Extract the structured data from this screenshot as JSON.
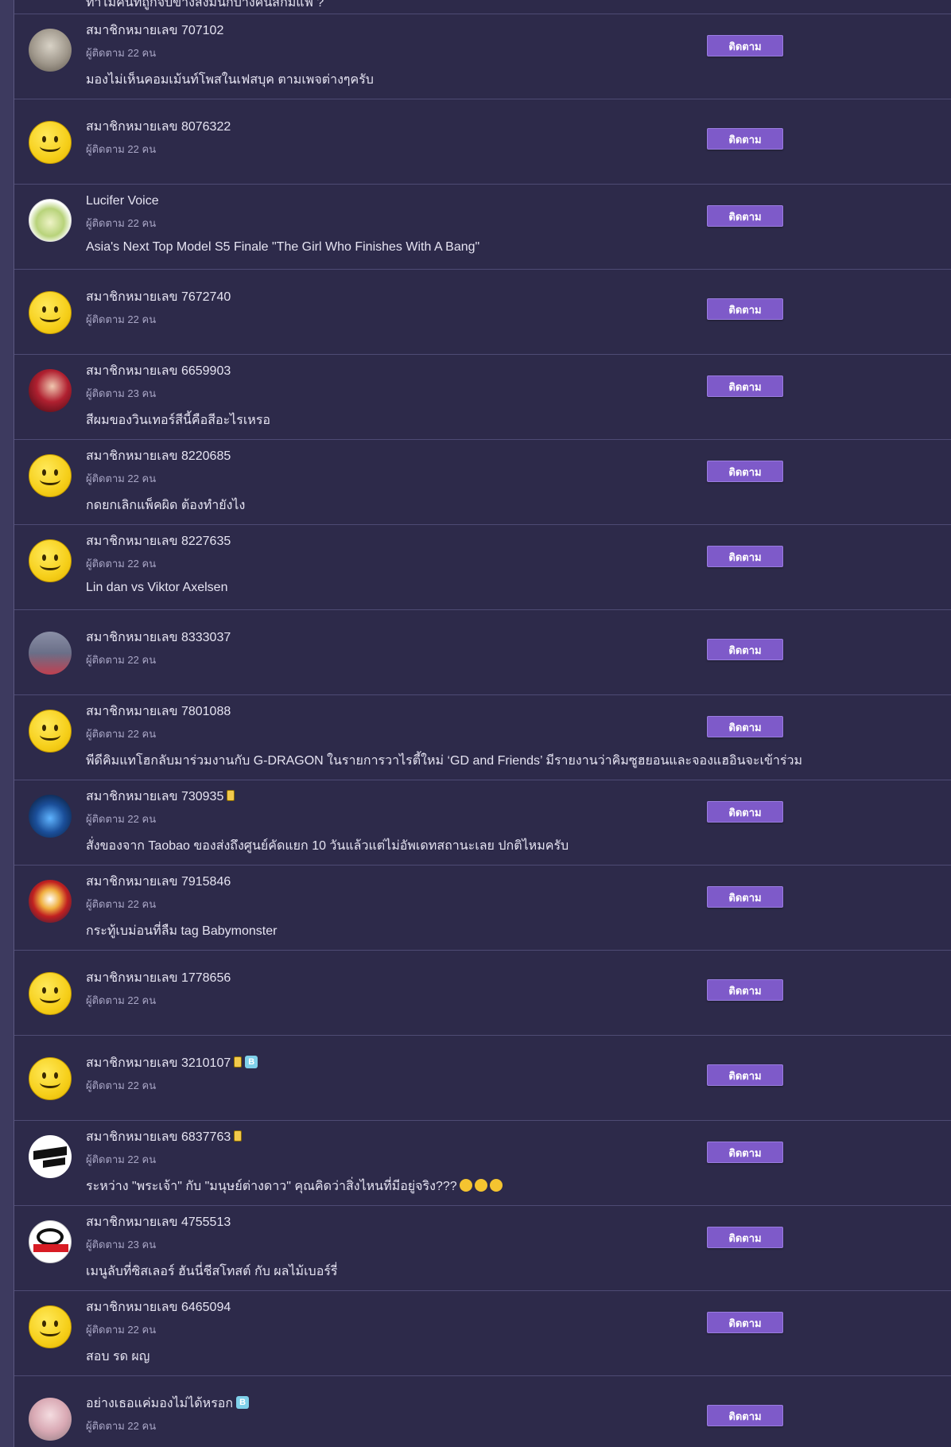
{
  "follow_label": "ติดตาม",
  "partial_topic": "ทำไมคนที่ถูกจับข้างสิ่งมีนักบางคนสักมีแฟ ?",
  "members": [
    {
      "name": "สมาชิกหมายเลข 707102",
      "followers": "ผู้ติดตาม 22 คน",
      "topic": "มองไม่เห็นคอมเม้นท์โพสในเฟสบุค ตามเพจต่างๆครับ",
      "avatar": "photo-man"
    },
    {
      "name": "สมาชิกหมายเลข 8076322",
      "followers": "ผู้ติดตาม 22 คน",
      "topic": "",
      "avatar": "smiley"
    },
    {
      "name": "Lucifer Voice",
      "followers": "ผู้ติดตาม 22 คน",
      "topic": "Asia's Next Top Model S5 Finale \"The Girl Who Finishes With A Bang\"",
      "avatar": "photo-cake"
    },
    {
      "name": "สมาชิกหมายเลข 7672740",
      "followers": "ผู้ติดตาม 22 คน",
      "topic": "",
      "avatar": "smiley"
    },
    {
      "name": "สมาชิกหมายเลข 6659903",
      "followers": "ผู้ติดตาม 23 คน",
      "topic": "สีผมของวินเทอร์สีนี้คือสีอะไรเหรอ",
      "avatar": "photo-girl"
    },
    {
      "name": "สมาชิกหมายเลข 8220685",
      "followers": "ผู้ติดตาม 22 คน",
      "topic": "กดยกเลิกแพ็คผิด ต้องทำยังไง",
      "avatar": "smiley"
    },
    {
      "name": "สมาชิกหมายเลข 8227635",
      "followers": "ผู้ติดตาม 22 คน",
      "topic": "Lin dan vs Viktor Axelsen",
      "avatar": "smiley"
    },
    {
      "name": "สมาชิกหมายเลข 8333037",
      "followers": "ผู้ติดตาม 22 คน",
      "topic": "",
      "avatar": "photo-sky"
    },
    {
      "name": "สมาชิกหมายเลข 7801088",
      "followers": "ผู้ติดตาม 22 คน",
      "topic": "พีดีคิมแทโฮกลับมาร่วมงานกับ G-DRAGON ในรายการวาไรตี้ใหม่ ‘GD and Friends’ มีรายงานว่าคิมซูฮยอนและจองแฮอินจะเข้าร่วม",
      "avatar": "smiley"
    },
    {
      "name": "สมาชิกหมายเลข 730935",
      "followers": "ผู้ติดตาม 22 คน",
      "topic": "สั่งของจาก Taobao ของส่งถึงศูนย์คัดแยก 10 วันแล้วแต่ไม่อัพเดทสถานะเลย ปกติไหมครับ",
      "avatar": "photo-car",
      "badge": true
    },
    {
      "name": "สมาชิกหมายเลข 7915846",
      "followers": "ผู้ติดตาม 22 คน",
      "topic": "กระทู้เบม่อนที่ลืม tag Babymonster",
      "avatar": "photo-mask"
    },
    {
      "name": "สมาชิกหมายเลข 1778656",
      "followers": "ผู้ติดตาม 22 คน",
      "topic": "",
      "avatar": "smiley"
    },
    {
      "name": "สมาชิกหมายเลข 3210107",
      "followers": "ผู้ติดตาม 22 คน",
      "topic": "",
      "avatar": "smiley",
      "badge": true,
      "badge_b": "B"
    },
    {
      "name": "สมาชิกหมายเลข 6837763",
      "followers": "ผู้ติดตาม 22 คน",
      "topic": "ระหว่าง \"พระเจ้า\" กับ \"มนุษย์ต่างดาว\" คุณคิดว่าสิ่งไหนที่มีอยู่จริง???",
      "avatar": "photo-weare",
      "badge": true,
      "emojis": 3
    },
    {
      "name": "สมาชิกหมายเลข 4755513",
      "followers": "ผู้ติดตาม 23 คน",
      "topic": "เมนูลับที่ซิสเลอร์ ฮันนี่ชีสโทสต์ กับ ผลไม้เบอร์รี่",
      "avatar": "photo-trd"
    },
    {
      "name": "สมาชิกหมายเลข 6465094",
      "followers": "ผู้ติดตาม 22 คน",
      "topic": "สอบ รด ผญ",
      "avatar": "smiley"
    },
    {
      "name": "อย่างเธอแค่มองไม่ได้หรอก",
      "followers": "ผู้ติดตาม 22 คน",
      "topic": "",
      "avatar": "photo-ribbon",
      "badge_b": "B"
    }
  ]
}
